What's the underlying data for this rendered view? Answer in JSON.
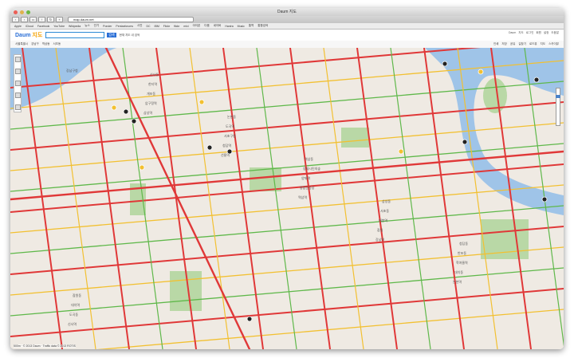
{
  "window": {
    "title": "Daum 지도"
  },
  "browser": {
    "url": "map.daum.net",
    "bookmarks": [
      "Apple",
      "iCloud",
      "Facebook",
      "YouTube",
      "Wikipedia",
      "뉴스",
      "인기",
      "Ponder",
      "Pentaxforums",
      "사진",
      "DC",
      "IBM",
      "Flickr",
      "flickr",
      "mixi",
      "아이폰",
      "다음",
      "네이버",
      "Hanira",
      "Music",
      "통역",
      "통합검색"
    ]
  },
  "header": {
    "logo": "Daum",
    "logo_suffix": "지도",
    "search_button": "검색",
    "checkbox_label": "현재 지도 내 검색",
    "links": [
      "Daum",
      "지도",
      "로그인",
      "회원",
      "설정",
      "도움말"
    ]
  },
  "subbar": {
    "breadcrumbs": [
      "서울특별시",
      "강남구",
      "역삼동",
      "서초동"
    ],
    "right_links": [
      "인쇄",
      "저장",
      "공유",
      "길찾기",
      "로드뷰",
      "지도",
      "스카이뷰"
    ]
  },
  "map": {
    "labels": [
      "강남구청",
      "삼성역",
      "선릉역",
      "역삼역",
      "강남역",
      "논현역",
      "신사역",
      "압구정역",
      "청담역",
      "종합운동장",
      "잠실",
      "대치동",
      "도곡동",
      "개포동",
      "서초구청",
      "양재역",
      "매봉역",
      "학여울역",
      "대치역",
      "한티역",
      "도곡역",
      "양재시민의숲",
      "서초동",
      "반포동",
      "잠원동",
      "신사동",
      "논현동",
      "역삼동",
      "삼성동",
      "청담동"
    ]
  },
  "footer": {
    "scale": "500m",
    "copyright": "© 2013 Daum · Traffic data © 2013 ROTIS"
  },
  "colors": {
    "accent": "#2b6fd6",
    "road_red": "#e03838",
    "road_yellow": "#f2c031",
    "road_green": "#5fb84a",
    "water": "#9fc4e8",
    "park": "#b9d8a6"
  }
}
